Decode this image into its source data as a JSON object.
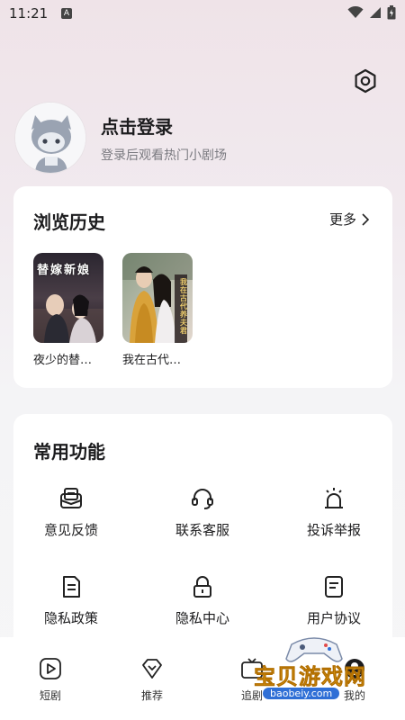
{
  "status_bar": {
    "time": "11:21",
    "a_badge": "A"
  },
  "profile": {
    "title": "点击登录",
    "subtitle": "登录后观看热门小剧场"
  },
  "history": {
    "title": "浏览历史",
    "more_label": "更多",
    "items": [
      {
        "label": "夜少的替…",
        "poster_text": "替嫁新娘"
      },
      {
        "label": "我在古代…",
        "poster_text": "我在古代养夫君"
      }
    ]
  },
  "functions": {
    "title": "常用功能",
    "items": [
      {
        "label": "意见反馈",
        "icon": "feedback-icon"
      },
      {
        "label": "联系客服",
        "icon": "headset-icon"
      },
      {
        "label": "投诉举报",
        "icon": "alarm-icon"
      },
      {
        "label": "隐私政策",
        "icon": "document-icon"
      },
      {
        "label": "隐私中心",
        "icon": "lock-icon"
      },
      {
        "label": "用户协议",
        "icon": "agreement-icon"
      }
    ]
  },
  "tabs": [
    {
      "label": "短剧",
      "icon": "play-icon"
    },
    {
      "label": "推荐",
      "icon": "diamond-icon"
    },
    {
      "label": "追剧",
      "icon": "tv-icon"
    },
    {
      "label": "我的",
      "icon": "profile-icon"
    }
  ],
  "watermark": {
    "text": "宝贝游戏网",
    "url": "baobeiy.com"
  }
}
